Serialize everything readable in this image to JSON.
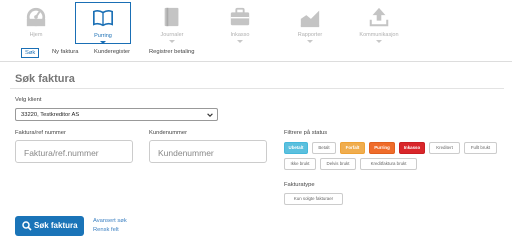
{
  "topnav": {
    "items": [
      {
        "label": "Hjem",
        "icon": "dashboard-icon"
      },
      {
        "label": "Purring",
        "icon": "book-open-icon",
        "active": true
      },
      {
        "label": "Journaler",
        "icon": "journal-icon"
      },
      {
        "label": "Inkasso",
        "icon": "briefcase-icon"
      },
      {
        "label": "Rapporter",
        "icon": "chart-icon"
      },
      {
        "label": "Kommunikasjon",
        "icon": "upload-icon"
      }
    ]
  },
  "subnav": {
    "items": [
      "Søk",
      "Ny faktura",
      "Kunderegister",
      "Registrer betaling"
    ]
  },
  "page": {
    "title": "Søk faktura",
    "client_label": "Velg klient",
    "client_value": "33220, Testkreditor AS",
    "invoice_label": "Faktura/ref nummer",
    "invoice_placeholder": "Faktura/ref.nummer",
    "customer_label": "Kundenummer",
    "customer_placeholder": "Kundenummer",
    "status_label": "Filtrere på status",
    "statuses": [
      "Ubetalt",
      "Betalt",
      "Forfalt",
      "Purring",
      "Inkasso",
      "Kreditert",
      "Fullt brukt",
      "Ikke brukt",
      "Delvis brukt",
      "Kreditfaktura brukt"
    ],
    "invoicetype_label": "Fakturatype",
    "invoicetype_option": "Kun solgte fakturaer",
    "search_button": "Søk faktura",
    "advanced_link": "Avansert søk",
    "clear_link": "Rensk felt"
  },
  "colors": {
    "primary": "#1a74b8",
    "ubetalt": "#5bc0de",
    "forfalt": "#f0ad4e",
    "purring": "#ef6c2a",
    "inkasso": "#d9262a"
  }
}
